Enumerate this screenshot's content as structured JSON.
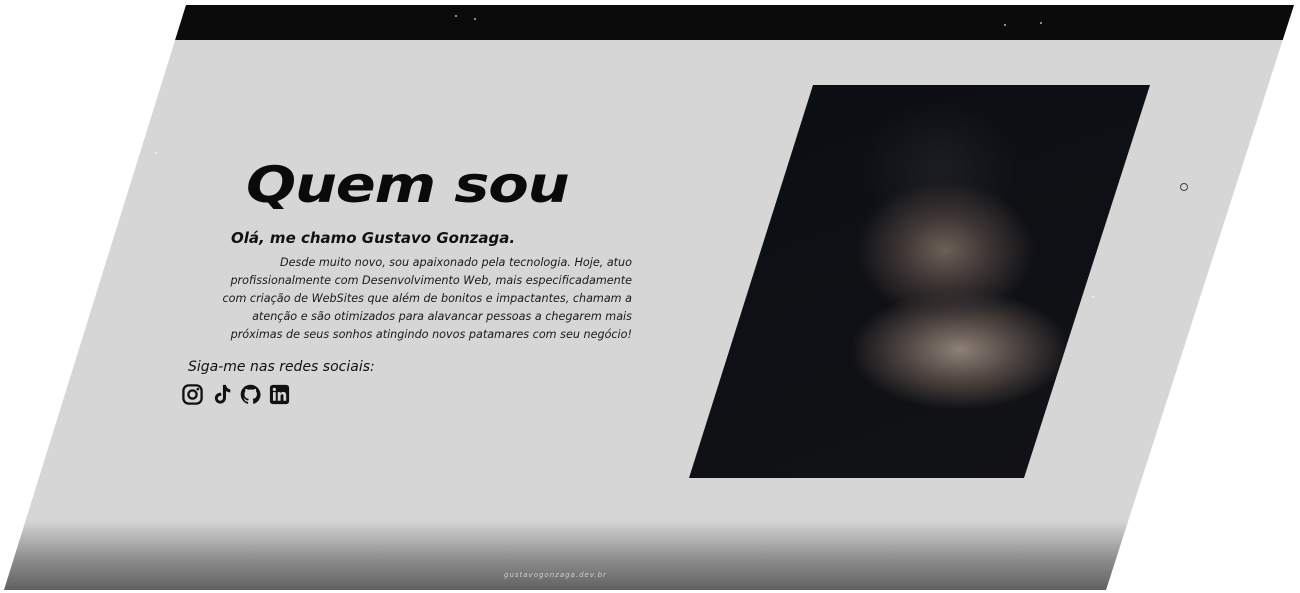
{
  "about": {
    "title": "Quem sou",
    "greeting": "Olá, me chamo Gustavo Gonzaga.",
    "bio_lines": [
      "Desde muito novo, sou apaixonado pela tecnologia. Hoje, atuo",
      "profissionalmente com Desenvolvimento Web, mais especificadamente",
      "com criação de WebSites que além de bonitos e impactantes, chamam a",
      "atenção e são otimizados para alavancar pessoas a chegarem mais",
      "próximas de seus sonhos atingindo novos patamares com seu negócio!"
    ],
    "follow_label": "Siga-me nas redes sociais:"
  },
  "socials": [
    {
      "icon": "instagram-icon"
    },
    {
      "icon": "tiktok-icon"
    },
    {
      "icon": "github-icon"
    },
    {
      "icon": "linkedin-icon"
    }
  ],
  "pager": {
    "indicator": "o"
  },
  "footer": {
    "domain": "gustavogonzaga.dev.br"
  },
  "colors": {
    "panel": "#d6d6d6",
    "dark": "#0b0b0b",
    "text": "#0a0a0a"
  }
}
